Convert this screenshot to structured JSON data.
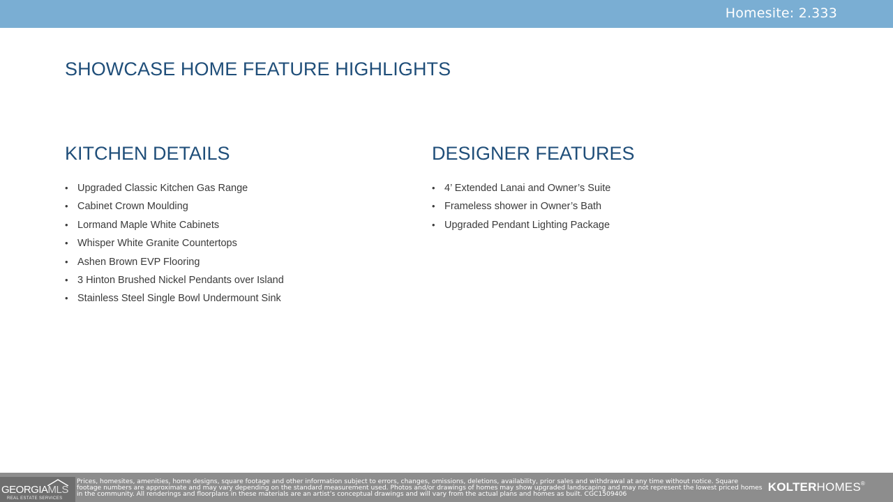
{
  "header": {
    "homesite": "Homesite: 2.333"
  },
  "page_title": "SHOWCASE HOME FEATURE HIGHLIGHTS",
  "kitchen": {
    "heading": "KITCHEN DETAILS",
    "items": [
      "Upgraded Classic Kitchen Gas Range",
      "Cabinet Crown Moulding",
      "Lormand Maple White Cabinets",
      "Whisper White Granite Countertops",
      "Ashen Brown EVP Flooring",
      "3 Hinton Brushed Nickel Pendants over Island",
      "Stainless Steel Single Bowl Undermount Sink"
    ]
  },
  "designer": {
    "heading": "DESIGNER FEATURES",
    "items": [
      "4’ Extended Lanai and Owner’s Suite",
      "Frameless shower in Owner’s Bath",
      "Upgraded Pendant Lighting Package"
    ]
  },
  "footer": {
    "gamls_georgia": "GEORGIA",
    "gamls_mls": "MLS",
    "gamls_subtitle": "REAL ESTATE SERVICES",
    "disclaimer": "Prices, homesites, amenities, home designs, square footage and other information subject to errors, changes, omissions, deletions, availability, prior sales and withdrawal at any time without notice. Square footage numbers are approximate and may vary depending on the standard measurement used. Photos and/or drawings of homes may show upgraded landscaping and may not represent the lowest priced homes in the community. All renderings and floorplans in these materials are an artist’s conceptual drawings and will vary from the actual plans and homes as built. CGC1509406",
    "kolter_bold": "KOLTER",
    "kolter_regular": "HOMES",
    "kolter_mark": "®"
  },
  "colors": {
    "top_bar": "#7aaed3",
    "heading": "#1f4e79",
    "footer": "#8d8d8d"
  }
}
